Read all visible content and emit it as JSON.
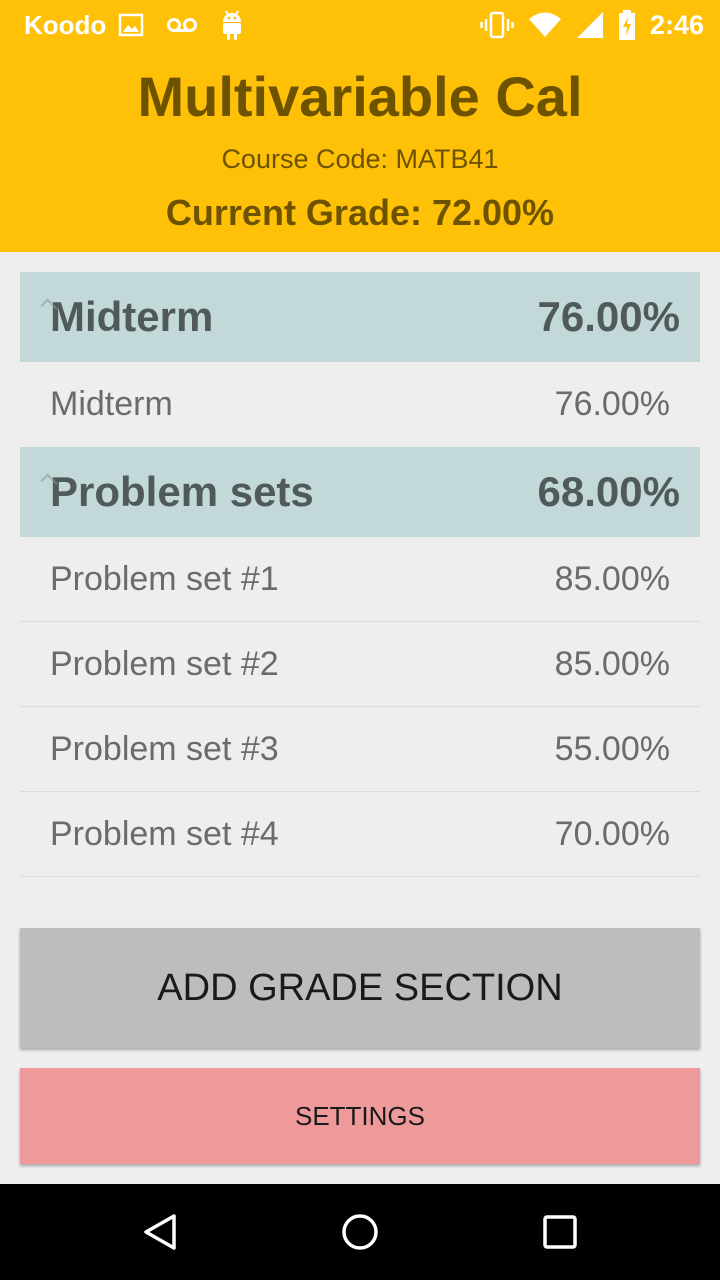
{
  "status_bar": {
    "carrier": "Koodo",
    "time": "2:46",
    "left_icons": [
      "image-icon",
      "voicemail-icon",
      "android-icon"
    ],
    "right_icons": [
      "vibrate-icon",
      "wifi-icon",
      "signal-icon",
      "battery-charging-icon"
    ]
  },
  "header": {
    "title": "Multivariable Cal",
    "course_code": "Course Code: MATB41",
    "current_grade": "Current Grade: 72.00%",
    "background": "#ffc107"
  },
  "sections": [
    {
      "name": "Midterm",
      "grade": "76.00%",
      "items": [
        {
          "name": "Midterm",
          "grade": "76.00%"
        }
      ]
    },
    {
      "name": "Problem sets",
      "grade": "68.00%",
      "items": [
        {
          "name": "Problem set #1",
          "grade": "85.00%"
        },
        {
          "name": "Problem set #2",
          "grade": "85.00%"
        },
        {
          "name": "Problem set #3",
          "grade": "55.00%"
        },
        {
          "name": "Problem set #4",
          "grade": "70.00%"
        }
      ]
    }
  ],
  "buttons": {
    "add_section": "ADD GRADE SECTION",
    "settings": "SETTINGS"
  },
  "nav": {
    "icons": [
      "back-icon",
      "home-icon",
      "recents-icon"
    ]
  }
}
